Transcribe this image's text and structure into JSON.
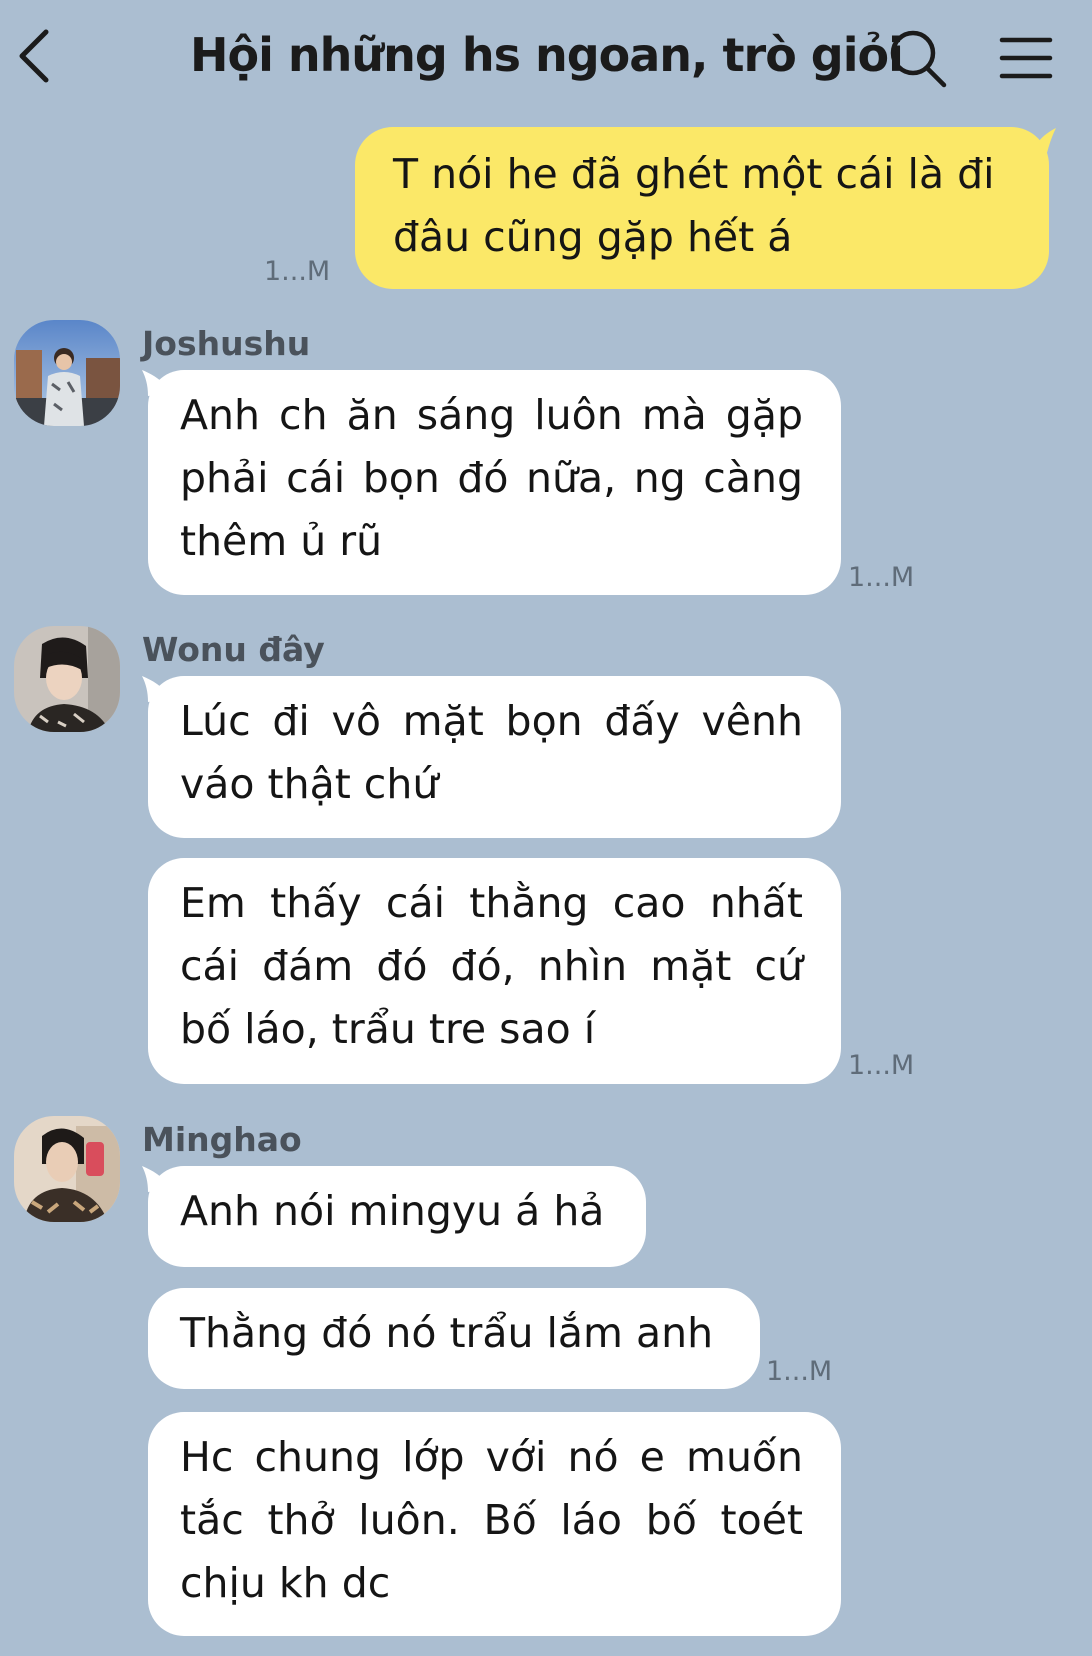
{
  "header": {
    "title": "Hội những hs ngoan, trò giỏi",
    "back_icon": "chevron-left-icon",
    "search_icon": "search-icon",
    "menu_icon": "hamburger-menu-icon"
  },
  "colors": {
    "background": "#abbed1",
    "outgoing_bubble": "#fbe868",
    "incoming_bubble": "#ffffff"
  },
  "messages": {
    "m1": {
      "text": "T nói he đã ghét một cái là đi đâu cũng gặp hết á",
      "time": "1...M"
    },
    "joshushu": {
      "name": "Joshushu",
      "m1": "Anh ch ăn sáng luôn mà gặp phải cái bọn đó nữa, ng càng thêm ủ rũ",
      "time": "1...M"
    },
    "wonu": {
      "name": "Wonu đây",
      "m1": "Lúc đi vô mặt bọn đấy vênh váo thật chứ",
      "m2": "Em thấy cái thằng cao nhất cái đám đó đó, nhìn mặt cứ bố láo, trẩu tre sao í",
      "time": "1...M"
    },
    "minghao": {
      "name": "Minghao",
      "m1": "Anh nói mingyu á hả",
      "m2": "Thằng đó nó trẩu lắm anh",
      "time": "1...M",
      "m3": "Hc chung lớp với nó e muốn tắc thở luôn. Bố láo bố toét chịu kh dc"
    }
  }
}
